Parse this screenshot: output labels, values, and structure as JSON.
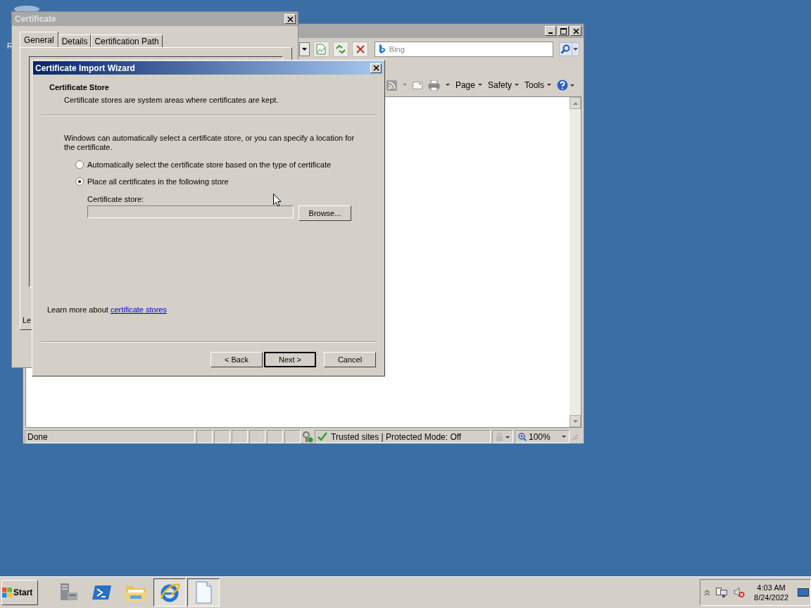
{
  "desktop": {
    "icon_label": "R"
  },
  "browser": {
    "search": {
      "placeholder": "Bing"
    },
    "command_menus": [
      {
        "label": "Page"
      },
      {
        "label": "Safety"
      },
      {
        "label": "Tools"
      }
    ],
    "status_bar": {
      "status": "Done",
      "zone": "Trusted sites | Protected Mode: Off",
      "zoom": "100%"
    }
  },
  "certificate_window": {
    "title": "Certificate",
    "tabs": [
      {
        "label": "General",
        "selected": true
      },
      {
        "label": "Details",
        "selected": false
      },
      {
        "label": "Certification Path",
        "selected": false
      }
    ],
    "cut_text": "Le"
  },
  "wizard": {
    "title": "Certificate Import Wizard",
    "heading": "Certificate Store",
    "subheading": "Certificate stores are system areas where certificates are kept.",
    "intro": "Windows can automatically select a certificate store, or you can specify a location for the certificate.",
    "options": [
      {
        "label": "Automatically select the certificate store based on the type of certificate",
        "selected": false
      },
      {
        "label": "Place all certificates in the following store",
        "selected": true
      }
    ],
    "store_label": "Certificate store:",
    "browse_button": "Browse...",
    "learn_more": {
      "text": "Learn more about",
      "link": "certificate stores"
    },
    "buttons": [
      {
        "label": "< Back",
        "default": false
      },
      {
        "label": "Next >",
        "default": true
      },
      {
        "label": "Cancel",
        "default": false
      }
    ]
  },
  "taskbar": {
    "start": "Start",
    "apps": [
      {
        "kind": "server",
        "open": false
      },
      {
        "kind": "shell",
        "open": false
      },
      {
        "kind": "folder",
        "open": false
      },
      {
        "kind": "browser",
        "open": true
      },
      {
        "kind": "document",
        "open": true
      }
    ],
    "clock": {
      "time": "4:03 AM",
      "date": "8/24/2022"
    }
  }
}
